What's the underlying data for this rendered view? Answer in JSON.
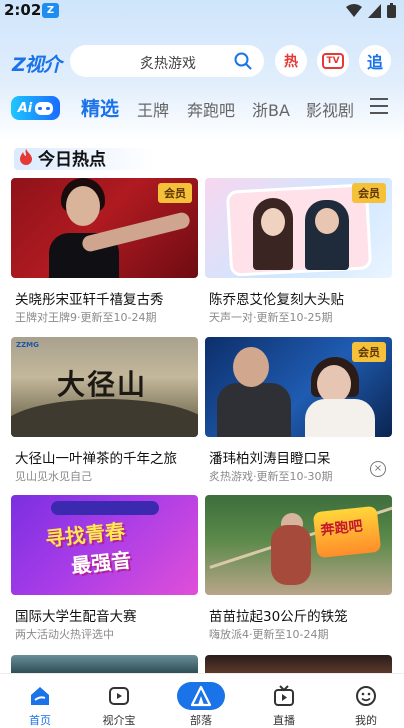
{
  "status_bar": {
    "time": "2:02"
  },
  "header": {
    "logo_text": "Z视介",
    "search_placeholder": "炙热游戏",
    "hot_label": "热",
    "tv_label": "TV",
    "follow_label": "追"
  },
  "tabs": {
    "ai_label": "Ai",
    "items": [
      {
        "label": "精选",
        "active": true
      },
      {
        "label": "王牌",
        "active": false
      },
      {
        "label": "奔跑吧",
        "active": false
      },
      {
        "label": "浙BA",
        "active": false
      },
      {
        "label": "影视剧",
        "active": false
      }
    ]
  },
  "section": {
    "title": "今日热点"
  },
  "cards": [
    {
      "title": "关晓彤宋亚轩千禧复古秀",
      "subtitle": "王牌对王牌9·更新至10-24期",
      "badge": "会员"
    },
    {
      "title": "陈乔恩艾伦复刻大头贴",
      "subtitle": "天声一对·更新至10-25期",
      "badge": "会员"
    },
    {
      "title": "大径山一叶禅茶的千年之旅",
      "subtitle": "见山见水见自己",
      "badge": "",
      "thumb_logo": "ZZMG",
      "thumb_text": "大径山"
    },
    {
      "title": "潘玮柏刘涛目瞪口呆",
      "subtitle": "炙热游戏·更新至10-30期",
      "badge": "会员"
    },
    {
      "title": "国际大学生配音大赛",
      "subtitle": "两大活动火热评选中",
      "badge": "",
      "thumb_line1": "寻找青春",
      "thumb_line2": "最强音"
    },
    {
      "title": "苗苗拉起30公斤的铁笼",
      "subtitle": "嗨放派4·更新至10-24期",
      "badge": "",
      "thumb_logo": "奔跑吧"
    }
  ],
  "bottom_nav": [
    {
      "label": "首页",
      "icon": "home-icon",
      "active": true
    },
    {
      "label": "视介宝",
      "icon": "tv-icon",
      "active": false
    },
    {
      "label": "部落",
      "icon": "tribe-icon",
      "active": false
    },
    {
      "label": "直播",
      "icon": "live-icon",
      "active": false
    },
    {
      "label": "我的",
      "icon": "profile-icon",
      "active": false
    }
  ],
  "colors": {
    "accent": "#1a73e8",
    "vip": "#f6c13a",
    "hot": "#e53935"
  }
}
